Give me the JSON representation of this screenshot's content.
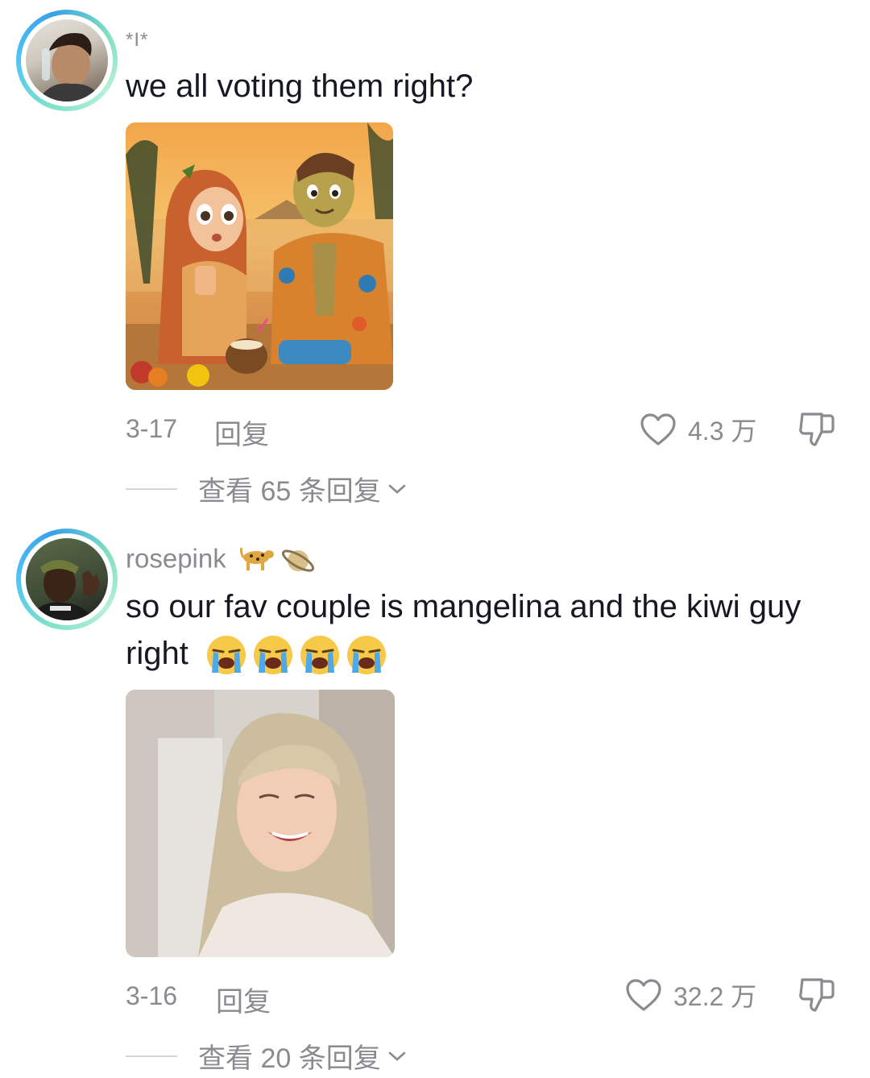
{
  "comments": [
    {
      "username": "*I*",
      "text": "we all voting them right?",
      "date": "3-17",
      "reply_label": "回复",
      "likes": "4.3 万",
      "view_replies": "查看 65 条回复",
      "media": "cartoon-couple-beach-image"
    },
    {
      "username": "rosepink",
      "username_emojis": [
        "leopard-emoji",
        "ringed-planet-emoji"
      ],
      "text": "so our fav couple is mangelina and the kiwi guy right",
      "text_emojis": [
        "loudly-crying-face-emoji",
        "loudly-crying-face-emoji",
        "loudly-crying-face-emoji",
        "loudly-crying-face-emoji"
      ],
      "date": "3-16",
      "reply_label": "回复",
      "likes": "32.2 万",
      "view_replies": "查看 20 条回复",
      "media": "blonde-woman-selfie-image"
    }
  ],
  "colors": {
    "meta": "#8a8a8f",
    "text": "#161823",
    "ring_start": "#7ee3c8",
    "ring_end": "#3aa0e8"
  }
}
